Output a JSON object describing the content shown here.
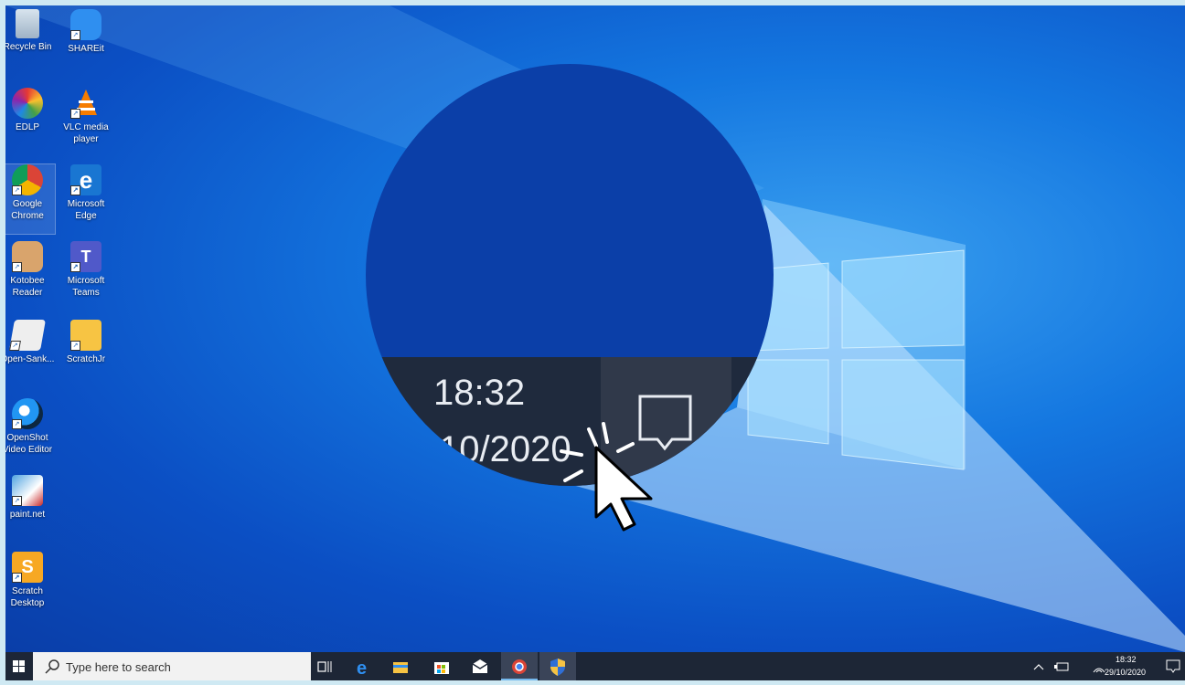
{
  "desktop_icons": [
    {
      "label": "Recycle Bin",
      "icon": "recycle-bin-icon"
    },
    {
      "label": "SHAREit",
      "icon": "shareit-icon"
    },
    {
      "label": "EDLP",
      "icon": "edlp-icon"
    },
    {
      "label": "VLC media player",
      "icon": "vlc-icon"
    },
    {
      "label": "Google Chrome",
      "icon": "chrome-icon"
    },
    {
      "label": "Microsoft Edge",
      "icon": "edge-icon"
    },
    {
      "label": "Kotobee Reader",
      "icon": "kotobee-icon"
    },
    {
      "label": "Microsoft Teams",
      "icon": "teams-icon"
    },
    {
      "label": "Open-Sank...",
      "icon": "opensankore-icon"
    },
    {
      "label": "ScratchJr",
      "icon": "scratchjr-icon"
    },
    {
      "label": "OpenShot Video Editor",
      "icon": "openshot-icon"
    },
    {
      "label": "paint.net",
      "icon": "paintnet-icon"
    },
    {
      "label": "Scratch Desktop",
      "icon": "scratch-icon"
    }
  ],
  "zoom": {
    "time": "18:32",
    "date": "10/2020"
  },
  "taskbar": {
    "search_placeholder": "Type here to search",
    "clock_time": "18:32",
    "clock_date": "29/10/2020"
  },
  "colors": {
    "taskbar": "#1d2636",
    "desktop": "#1477e0"
  }
}
